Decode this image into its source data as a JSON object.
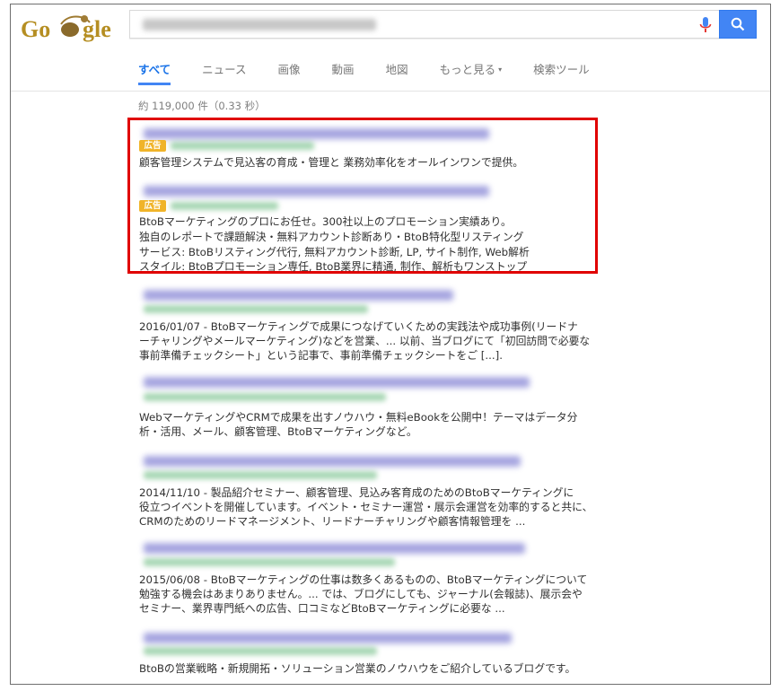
{
  "logo": {
    "text": "Google"
  },
  "search": {
    "query_blurred": true
  },
  "tabs": [
    {
      "label": "すべて",
      "active": true
    },
    {
      "label": "ニュース"
    },
    {
      "label": "画像"
    },
    {
      "label": "動画"
    },
    {
      "label": "地図"
    },
    {
      "label": "もっと見る",
      "caret": "▾"
    },
    {
      "label": "検索ツール"
    }
  ],
  "stats": "約 119,000 件（0.33 秒）",
  "ads": [
    {
      "badge": "広告",
      "lines": [
        "顧客管理システムで見込客の育成・管理と 業務効率化をオールインワンで提供。"
      ]
    },
    {
      "badge": "広告",
      "lines": [
        "BtoBマーケティングのプロにお任せ。300社以上のプロモーション実績あり。",
        "独自のレポートで課題解決・無料アカウント診断あり・BtoB特化型リスティング",
        "サービス: BtoBリスティング代行, 無料アカウント診断, LP, サイト制作, Web解析",
        "スタイル: BtoBプロモーション専任, BtoB業界に精通, 制作、解析もワンストップ"
      ]
    }
  ],
  "results": [
    {
      "lines": [
        "2016/01/07 - BtoBマーケティングで成果につなげていくための実践法や成功事例(リードナ",
        "ーチャリングやメールマーケティング)などを営業、... 以前、当ブログにて「初回訪問で必要な",
        "事前準備チェックシート」という記事で、事前準備チェックシートをご [...]."
      ]
    },
    {
      "lines": [
        "WebマーケティングやCRMで成果を出すノウハウ・無料eBookを公開中！テーマはデータ分",
        "析・活用、メール、顧客管理、BtoBマーケティングなど。"
      ]
    },
    {
      "lines": [
        "2014/11/10 - 製品紹介セミナー、顧客管理、見込み客育成のためのBtoBマーケティングに",
        "役立つイベントを開催しています。イベント・セミナー運営・展示会運営を効率的すると共に、",
        "CRMのためのリードマネージメント、リードナーチャリングや顧客情報管理を ..."
      ]
    },
    {
      "lines": [
        "2015/06/08 - BtoBマーケティングの仕事は数多くあるものの、BtoBマーケティングについて",
        "勉強する機会はあまりありません。... では、ブログにしても、ジャーナル(会報誌)、展示会や",
        "セミナー、業界専門紙への広告、口コミなどBtoBマーケティングに必要な ..."
      ]
    },
    {
      "lines": [
        "BtoBの営業戦略・新規開拓・ソリューション営業のノウハウをご紹介しているブログです。"
      ]
    }
  ],
  "colors": {
    "search_button": "#4285f4",
    "ad_highlight_border": "#e00000",
    "ad_badge": "#f0b429",
    "active_tab": "#1a73e8"
  }
}
